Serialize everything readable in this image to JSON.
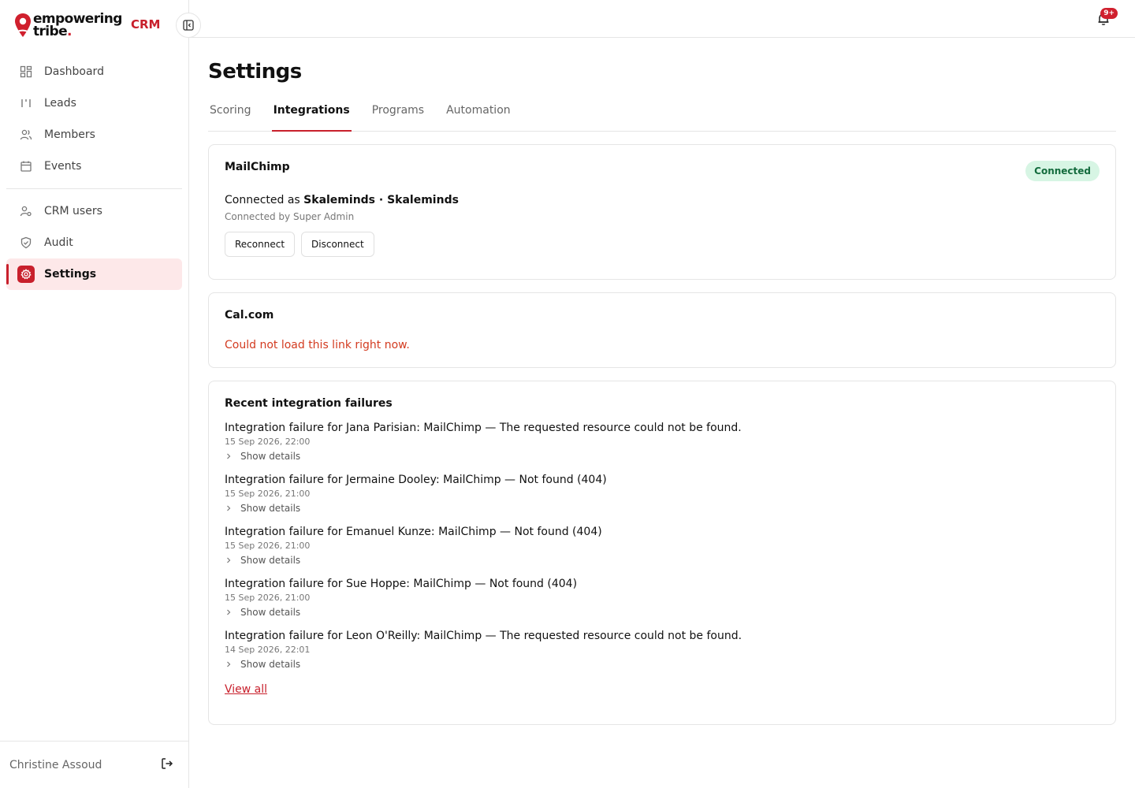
{
  "brand": {
    "line1": "empowering",
    "line2": "tribe",
    "line2_dot": ".",
    "crm": "CRM"
  },
  "sidebar": {
    "items": [
      {
        "label": "Dashboard",
        "icon": "dashboard-icon"
      },
      {
        "label": "Leads",
        "icon": "leads-icon"
      },
      {
        "label": "Members",
        "icon": "members-icon"
      },
      {
        "label": "Events",
        "icon": "calendar-icon"
      },
      {
        "label": "CRM users",
        "icon": "user-settings-icon"
      },
      {
        "label": "Audit",
        "icon": "shield-check-icon"
      },
      {
        "label": "Settings",
        "icon": "gear-icon",
        "active": true
      }
    ],
    "user_name": "Christine Assoud"
  },
  "topbar": {
    "notification_badge": "9+"
  },
  "page": {
    "title": "Settings",
    "tabs": [
      {
        "label": "Scoring"
      },
      {
        "label": "Integrations",
        "active": true
      },
      {
        "label": "Programs"
      },
      {
        "label": "Automation"
      }
    ]
  },
  "mailchimp": {
    "title": "MailChimp",
    "status": "Connected",
    "connected_as_prefix": "Connected as",
    "account": "Skaleminds · Skaleminds",
    "connected_by": "Connected by Super Admin",
    "reconnect_label": "Reconnect",
    "disconnect_label": "Disconnect"
  },
  "calcom": {
    "title": "Cal.com",
    "error": "Could not load this link right now."
  },
  "failures": {
    "title": "Recent integration failures",
    "details_label": "Show details",
    "view_all": "View all",
    "items": [
      {
        "title": "Integration failure for Jana Parisian: MailChimp — The requested resource could not be found.",
        "date": "15 Sep 2026, 22:00"
      },
      {
        "title": "Integration failure for Jermaine Dooley: MailChimp — Not found (404)",
        "date": "15 Sep 2026, 21:00"
      },
      {
        "title": "Integration failure for Emanuel Kunze: MailChimp — Not found (404)",
        "date": "15 Sep 2026, 21:00"
      },
      {
        "title": "Integration failure for Sue Hoppe: MailChimp — Not found (404)",
        "date": "15 Sep 2026, 21:00"
      },
      {
        "title": "Integration failure for Leon O'Reilly: MailChimp — The requested resource could not be found.",
        "date": "14 Sep 2026, 22:01"
      }
    ]
  },
  "colors": {
    "accent": "#c8202c",
    "connected_bg": "#d7f5e4",
    "connected_text": "#136b3d",
    "error": "#d33b20"
  }
}
